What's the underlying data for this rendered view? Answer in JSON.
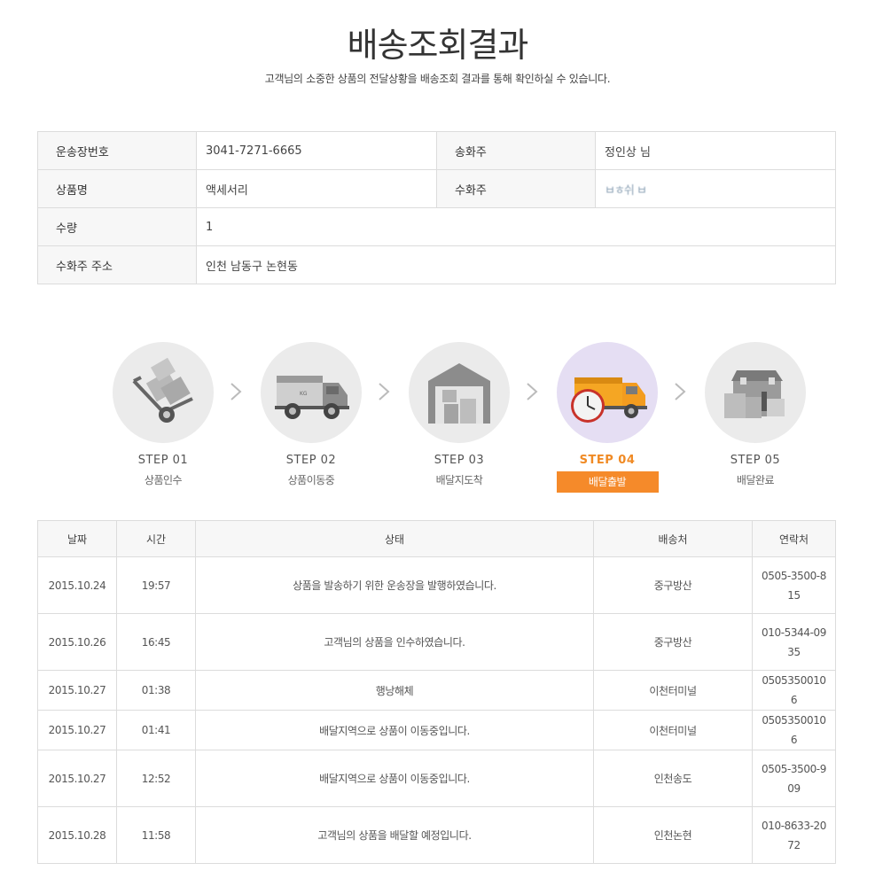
{
  "header": {
    "title": "배송조회결과",
    "subtitle": "고객님의 소중한 상품의 전달상황을 배송조회 결과를 통해 확인하실 수 있습니다."
  },
  "info": {
    "tracking_label": "운송장번호",
    "tracking_value": "3041-7271-6665",
    "sender_label": "송화주",
    "sender_value": "정인상 님",
    "product_label": "상품명",
    "product_value": "액세서리",
    "receiver_label": "수화주",
    "receiver_value": "ㅂㅎ쉬 ㅂ",
    "qty_label": "수량",
    "qty_value": "1",
    "address_label": "수화주 주소",
    "address_value": "인천 남동구 논현동"
  },
  "steps": [
    {
      "num": "STEP 01",
      "label": "상품인수",
      "icon": "hand-truck-icon"
    },
    {
      "num": "STEP 02",
      "label": "상품이동중",
      "icon": "truck-icon"
    },
    {
      "num": "STEP 03",
      "label": "배달지도착",
      "icon": "warehouse-icon"
    },
    {
      "num": "STEP 04",
      "label": "배달출발",
      "icon": "delivery-truck-clock-icon",
      "active": true
    },
    {
      "num": "STEP 05",
      "label": "배달완료",
      "icon": "house-icon"
    }
  ],
  "colors": {
    "accent": "#f58a2a",
    "active_circle": "#e5def3",
    "circle": "#ebebeb"
  },
  "history": {
    "headers": [
      "날짜",
      "시간",
      "상태",
      "배송처",
      "연락처"
    ],
    "rows": [
      {
        "date": "2015.10.24",
        "time": "19:57",
        "status": "상품을 발송하기 위한 운송장을 발행하였습니다.",
        "office": "중구방산",
        "phone": "0505-3500-815"
      },
      {
        "date": "2015.10.26",
        "time": "16:45",
        "status": "고객님의 상품을 인수하였습니다.",
        "office": "중구방산",
        "phone": "010-5344-0935"
      },
      {
        "date": "2015.10.27",
        "time": "01:38",
        "status": "행낭해체",
        "office": "이천터미널",
        "phone": "05053500106"
      },
      {
        "date": "2015.10.27",
        "time": "01:41",
        "status": "배달지역으로 상품이 이동중입니다.",
        "office": "이천터미널",
        "phone": "05053500106"
      },
      {
        "date": "2015.10.27",
        "time": "12:52",
        "status": "배달지역으로 상품이 이동중입니다.",
        "office": "인천송도",
        "phone": "0505-3500-909"
      },
      {
        "date": "2015.10.28",
        "time": "11:58",
        "status": "고객님의 상품을 배달할 예정입니다.",
        "office": "인천논현",
        "phone": "010-8633-2072"
      }
    ]
  }
}
